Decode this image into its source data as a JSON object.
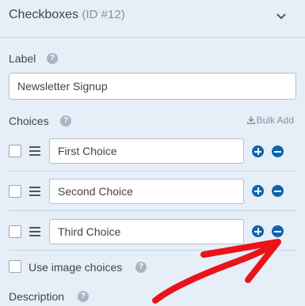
{
  "header": {
    "title": "Checkboxes",
    "field_id": "(ID #12)"
  },
  "label_section": {
    "title": "Label",
    "help": "?",
    "value": "Newsletter Signup"
  },
  "choices_section": {
    "title": "Choices",
    "help": "?",
    "bulk_add_label": "Bulk Add",
    "items": [
      {
        "label": "First Choice",
        "checked": false
      },
      {
        "label": "Second Choice",
        "checked": false
      },
      {
        "label": "Third Choice",
        "checked": false
      }
    ]
  },
  "image_choices": {
    "label": "Use image choices",
    "help": "?",
    "checked": false
  },
  "description": {
    "title": "Description",
    "help": "?"
  },
  "colors": {
    "accent": "#0e63ad",
    "annotation_arrow": "#e8141a",
    "background": "#e6eef8"
  }
}
